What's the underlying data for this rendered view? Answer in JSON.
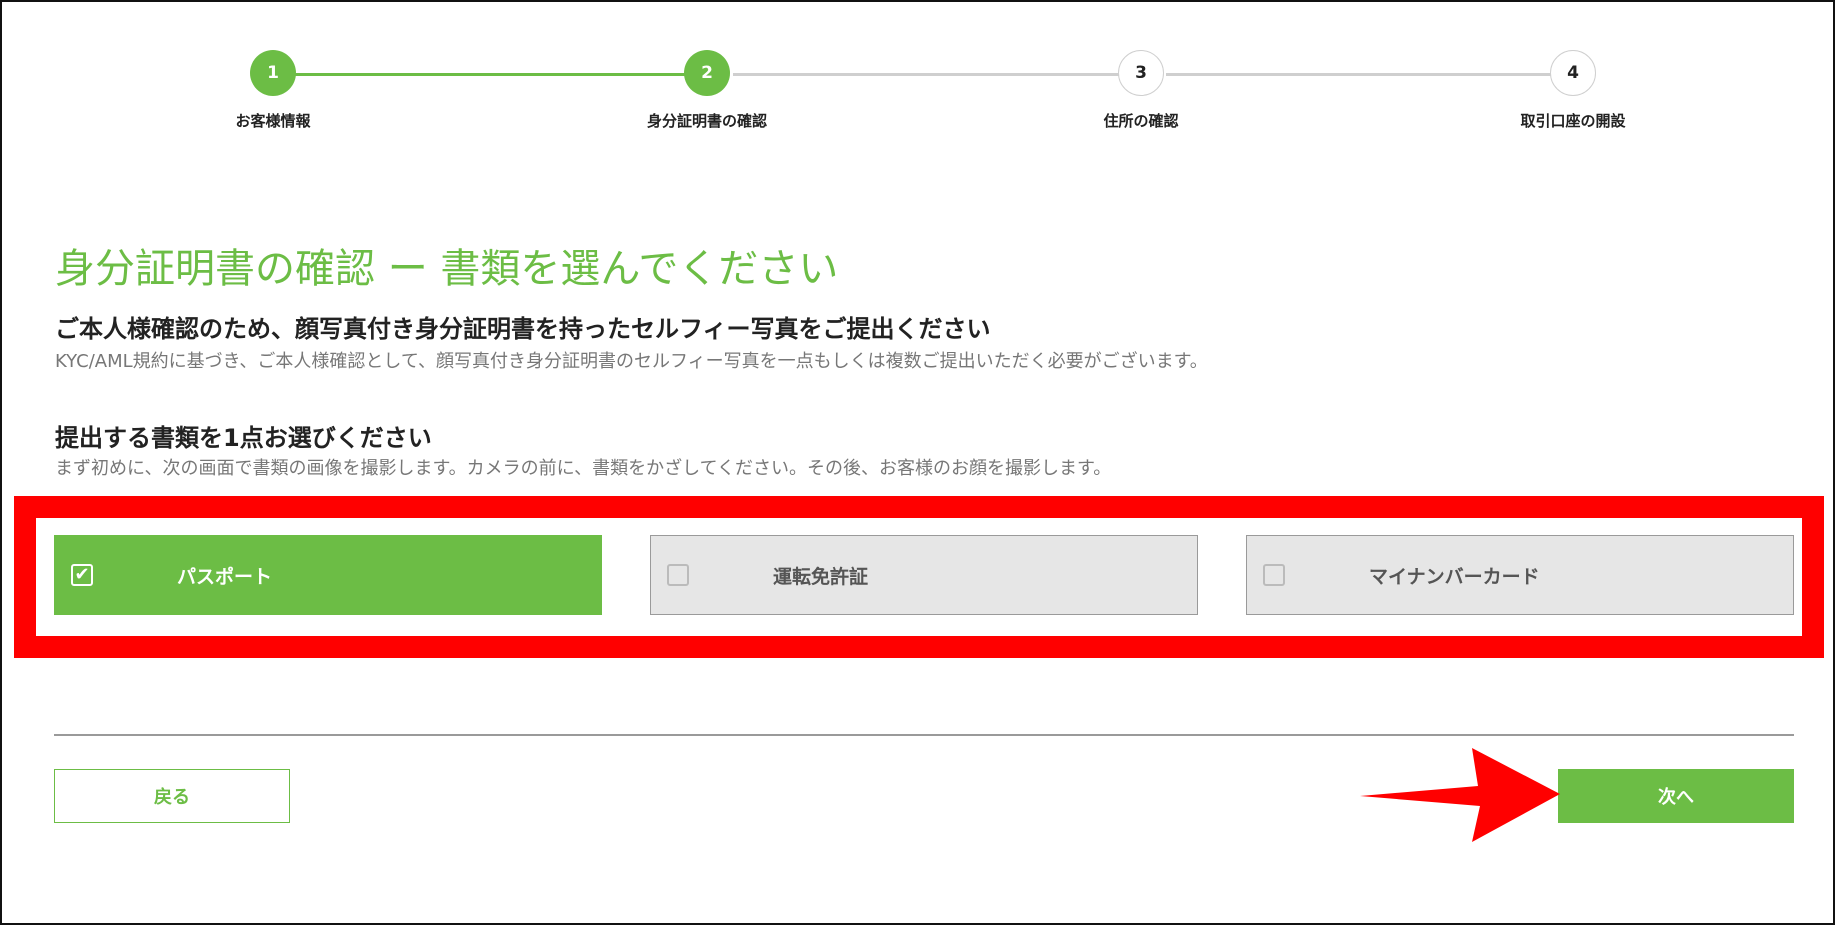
{
  "stepper": {
    "steps": [
      {
        "number": "1",
        "label": "お客様情報",
        "state": "complete"
      },
      {
        "number": "2",
        "label": "身分証明書の確認",
        "state": "current"
      },
      {
        "number": "3",
        "label": "住所の確認",
        "state": "pending"
      },
      {
        "number": "4",
        "label": "取引口座の開設",
        "state": "pending"
      }
    ]
  },
  "page": {
    "title": "身分証明書の確認 ー 書類を選んでください"
  },
  "selfie_section": {
    "heading": "ご本人様確認のため、顔写真付き身分証明書を持ったセルフィー写真をご提出ください",
    "description": "KYC/AML規約に基づき、ご本人様確認として、顔写真付き身分証明書のセルフィー写真を一点もしくは複数ご提出いただく必要がございます。"
  },
  "document_section": {
    "heading": "提出する書類を1点お選びください",
    "description": "まず初めに、次の画面で書類の画像を撮影します。カメラの前に、書類をかざしてください。その後、お客様のお顔を撮影します。",
    "options": [
      {
        "label": "パスポート",
        "selected": true
      },
      {
        "label": "運転免許証",
        "selected": false
      },
      {
        "label": "マイナンバーカード",
        "selected": false
      }
    ]
  },
  "buttons": {
    "back_label": "戻る",
    "next_label": "次へ"
  },
  "colors": {
    "accent": "#6cbd45",
    "annotation": "#ff0000"
  },
  "icons": {
    "checked": "checkbox-checked-icon",
    "unchecked": "checkbox-unchecked-icon",
    "annotation_arrow": "arrow-right-icon"
  }
}
